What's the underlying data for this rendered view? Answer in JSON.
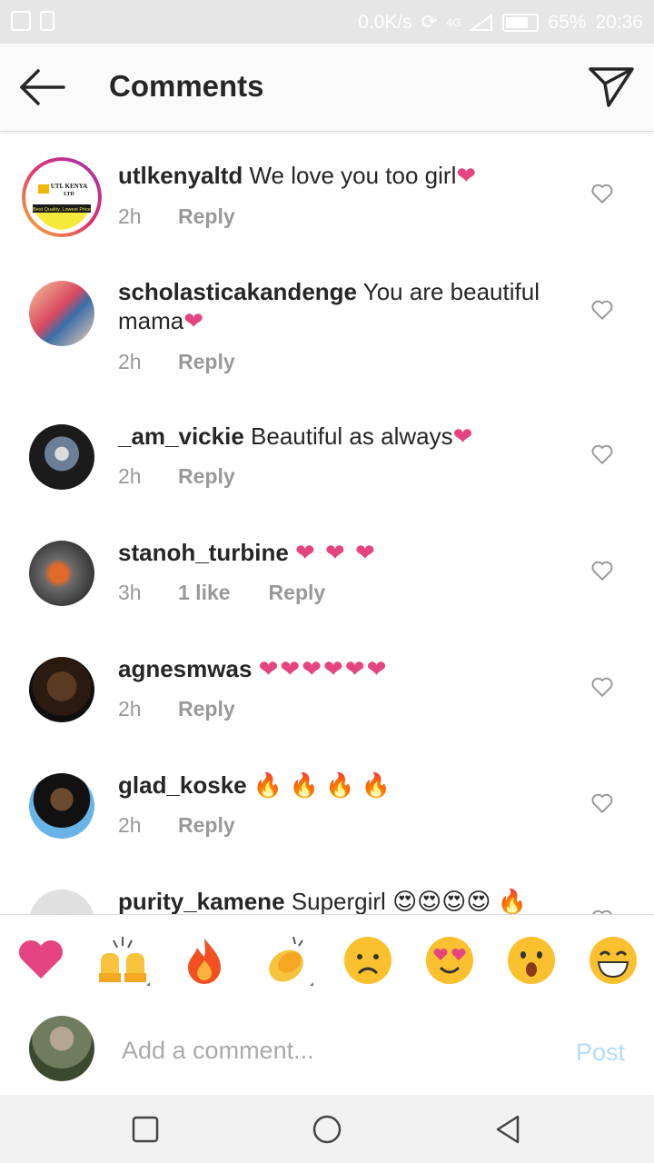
{
  "status_bar": {
    "speed": "0.0K/s",
    "network": "4G",
    "battery": "65%",
    "time": "20:36"
  },
  "header": {
    "title": "Comments"
  },
  "comments": [
    {
      "user": "utlkenyaltd",
      "text": "We love you too girl",
      "emoji": "❤",
      "time": "2h",
      "likes": "",
      "reply": "Reply"
    },
    {
      "user": "scholasticakandenge",
      "text": "You are beautiful mama",
      "emoji": "❤",
      "time": "2h",
      "likes": "",
      "reply": "Reply"
    },
    {
      "user": "_am_vickie",
      "text": "Beautiful as always",
      "emoji": "❤",
      "time": "2h",
      "likes": "",
      "reply": "Reply"
    },
    {
      "user": "stanoh_turbine",
      "text": "",
      "emoji": "❤ ❤ ❤",
      "time": "3h",
      "likes": "1 like",
      "reply": "Reply"
    },
    {
      "user": "agnesmwas",
      "text": "",
      "emoji": "❤❤❤❤❤❤",
      "time": "2h",
      "likes": "",
      "reply": "Reply"
    },
    {
      "user": "glad_koske",
      "text": "",
      "emoji": "🔥 🔥 🔥 🔥",
      "time": "2h",
      "likes": "",
      "reply": "Reply"
    },
    {
      "user": "purity_kamene",
      "text": "Supergirl",
      "emoji": "😍😍😍😍 🔥",
      "time": "",
      "likes": "",
      "reply": ""
    }
  ],
  "logo_text": {
    "brand": "UTL KENYA LTD",
    "tagline": "Best Quality, Lowest Price"
  },
  "emoji_bar": [
    "heart",
    "raised-hands",
    "fire",
    "clapping-hands",
    "sad-face",
    "heart-eyes-face",
    "surprised-face",
    "grinning-face"
  ],
  "composer": {
    "placeholder": "Add a comment...",
    "post_label": "Post"
  },
  "colors": {
    "heart": "#e4447f",
    "post": "#b3dbff",
    "text": "#262626",
    "muted": "#999999"
  }
}
